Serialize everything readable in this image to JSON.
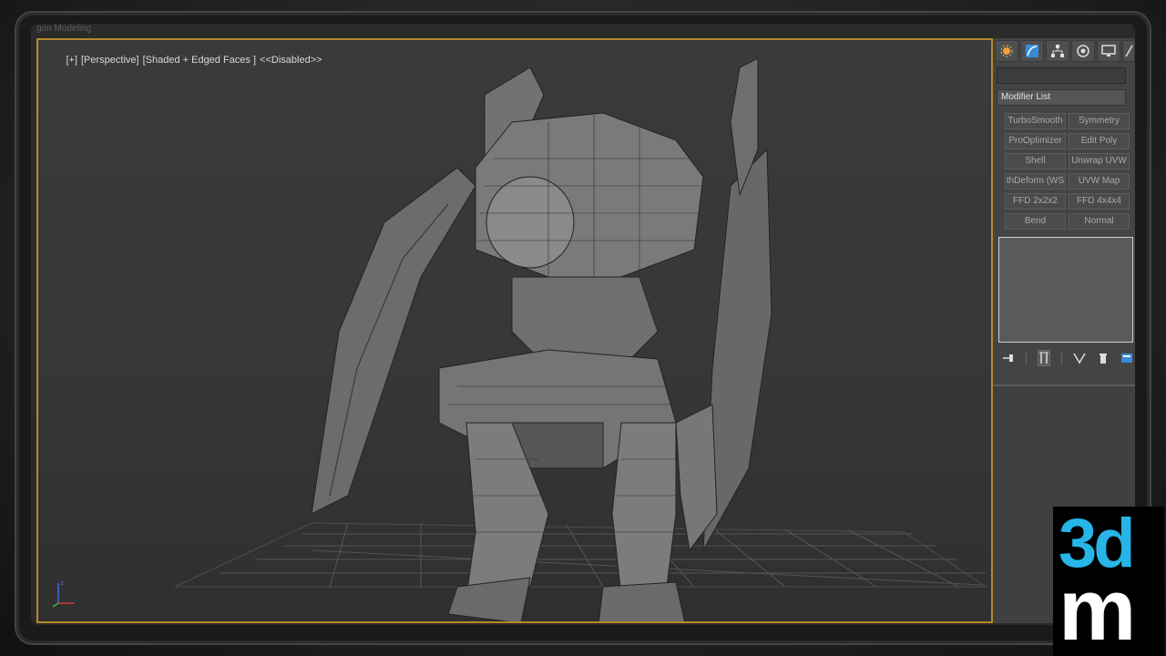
{
  "window": {
    "ghost_title": "gon Modeling"
  },
  "viewport": {
    "labels": [
      "[+]",
      "[Perspective]",
      "[Shaded + Edged Faces ]",
      "<<Disabled>>"
    ],
    "active_border_color": "#b58a2b"
  },
  "command_panel": {
    "tabs": [
      "create-icon",
      "modify-icon",
      "hierarchy-icon",
      "motion-icon",
      "display-icon",
      "utilities-icon"
    ],
    "modifier_list_label": "Modifier List",
    "modifiers": [
      "TurboSmooth",
      "Symmetry",
      "ProOptimizer",
      "Edit Poly",
      "Shell",
      "Unwrap UVW",
      "thDeform (WS",
      "UVW Map",
      "FFD 2x2x2",
      "FFD 4x4x4",
      "Bend",
      "Normal"
    ],
    "stack_toolbar": [
      "pin-stack-icon",
      "show-end-result-icon",
      "make-unique-icon",
      "remove-modifier-icon",
      "configure-sets-icon"
    ]
  },
  "logo": {
    "top": "3d",
    "bottom": "m",
    "accent": "#27b5e8"
  }
}
